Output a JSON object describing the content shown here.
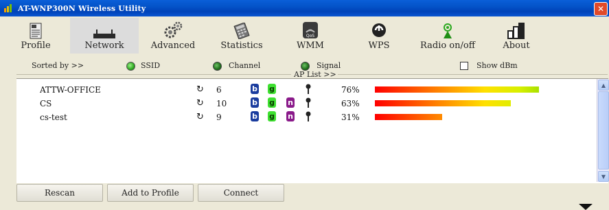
{
  "window": {
    "title": "AT-WNP300N Wireless Utility",
    "close_icon": "close-icon"
  },
  "toolbar": {
    "items": [
      {
        "label": "Profile",
        "icon": "profile-document-icon"
      },
      {
        "label": "Network",
        "icon": "network-router-icon",
        "active": true
      },
      {
        "label": "Advanced",
        "icon": "gears-icon"
      },
      {
        "label": "Statistics",
        "icon": "calculator-icon"
      },
      {
        "label": "WMM",
        "icon": "qos-icon"
      },
      {
        "label": "WPS",
        "icon": "wps-icon"
      },
      {
        "label": "Radio on/off",
        "icon": "radio-antenna-icon"
      },
      {
        "label": "About",
        "icon": "about-bars-icon"
      }
    ]
  },
  "sort": {
    "sorted_by_label": "Sorted by >>",
    "ssid_label": "SSID",
    "channel_label": "Channel",
    "signal_label": "Signal",
    "show_dbm_label": "Show dBm",
    "selected": "SSID",
    "show_dbm_checked": false
  },
  "aplist": {
    "header": "AP List >>",
    "rows": [
      {
        "ssid": "ATTW-OFFICE",
        "channel": "6",
        "modes": [
          "b",
          "g"
        ],
        "secured": true,
        "signal": "76%",
        "signal_value": 76
      },
      {
        "ssid": "CS",
        "channel": "10",
        "modes": [
          "b",
          "g",
          "n"
        ],
        "secured": true,
        "signal": "63%",
        "signal_value": 63
      },
      {
        "ssid": "cs-test",
        "channel": "9",
        "modes": [
          "b",
          "g",
          "n"
        ],
        "secured": true,
        "signal": "31%",
        "signal_value": 31
      }
    ]
  },
  "buttons": {
    "rescan": "Rescan",
    "add_to_profile": "Add to Profile",
    "connect": "Connect"
  },
  "colors": {
    "titlebar": "#0453c8",
    "active_tab": "#dcdcdc",
    "mode_b": "#1a3c9e",
    "mode_g": "#3ee030",
    "mode_n": "#8a1a8a"
  }
}
